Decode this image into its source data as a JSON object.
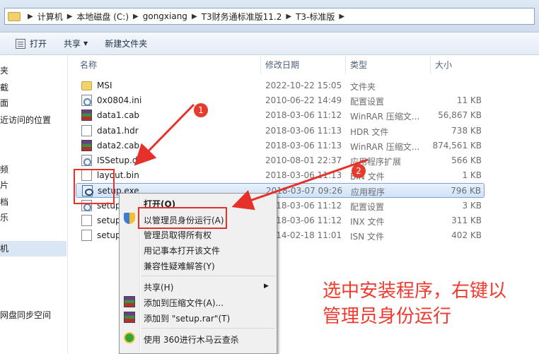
{
  "address": {
    "crumbs": [
      "计算机",
      "本地磁盘 (C:)",
      "gongxiang",
      "T3财务通标准版11.2",
      "T3-标准版"
    ]
  },
  "toolbar": {
    "open_label": "打开",
    "share_label": "共享",
    "new_folder_label": "新建文件夹"
  },
  "nav": {
    "items": [
      "夹",
      "截",
      "面",
      "近访问的位置",
      "频",
      "片",
      "档",
      "乐",
      "机",
      "",
      "网盘同步空间"
    ]
  },
  "columns": {
    "name": "名称",
    "date": "修改日期",
    "type": "类型",
    "size": "大小"
  },
  "files": [
    {
      "name": "MSI",
      "date": "2022-10-22 15:05",
      "type": "文件夹",
      "size": "",
      "icon": "folder-icon"
    },
    {
      "name": "0x0804.ini",
      "date": "2010-06-22 14:49",
      "type": "配置设置",
      "size": "11 KB",
      "icon": "settings-file-icon"
    },
    {
      "name": "data1.cab",
      "date": "2018-03-06 11:12",
      "type": "WinRAR 压缩文...",
      "size": "56,867 KB",
      "icon": "winrar-archive-icon"
    },
    {
      "name": "data1.hdr",
      "date": "2018-03-06 11:13",
      "type": "HDR 文件",
      "size": "738 KB",
      "icon": "document-icon"
    },
    {
      "name": "data2.cab",
      "date": "2018-03-06 11:13",
      "type": "WinRAR 压缩文...",
      "size": "874,561 KB",
      "icon": "winrar-archive-icon"
    },
    {
      "name": "ISSetup.dll",
      "date": "2010-08-01 22:37",
      "type": "应用程序扩展",
      "size": "566 KB",
      "icon": "settings-file-icon"
    },
    {
      "name": "layout.bin",
      "date": "2018-03-06 11:13",
      "type": "BIN 文件",
      "size": "1 KB",
      "icon": "document-icon"
    },
    {
      "name": "setup.exe",
      "date": "2018-03-07 09:26",
      "type": "应用程序",
      "size": "796 KB",
      "icon": "application-icon"
    },
    {
      "name": "setup",
      "date": "2018-03-06 11:12",
      "type": "配置设置",
      "size": "3 KB",
      "icon": "settings-file-icon"
    },
    {
      "name": "setup",
      "date": "2018-03-06 11:12",
      "type": "INX 文件",
      "size": "311 KB",
      "icon": "document-icon"
    },
    {
      "name": "setup",
      "date": "2014-02-18 11:01",
      "type": "ISN 文件",
      "size": "402 KB",
      "icon": "document-icon"
    }
  ],
  "context_menu": {
    "open": "打开(O)",
    "run_as_admin": "以管理员身份运行(A)",
    "take_ownership": "管理员取得所有权",
    "open_notepad": "用记事本打开该文件",
    "compat": "兼容性疑难解答(Y)",
    "share": "共享(H)",
    "add_archive": "添加到压缩文件(A)...",
    "add_rar": "添加到 \"setup.rar\"(T)",
    "scan_360": "使用 360进行木马云查杀"
  },
  "annotations": {
    "badge1": "1",
    "badge2": "2",
    "note_line1": "选中安装程序，右键以",
    "note_line2": "管理员身份运行",
    "color": "#e8302b"
  }
}
